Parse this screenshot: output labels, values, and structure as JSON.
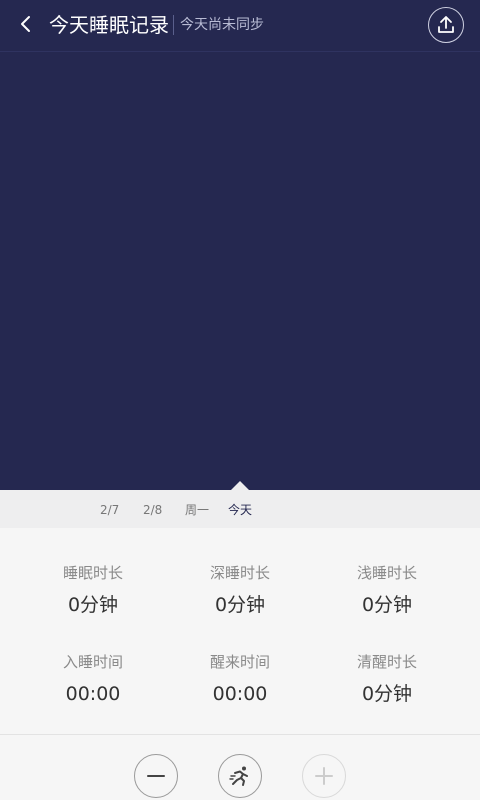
{
  "header": {
    "title": "今天睡眠记录",
    "subtitle": "今天尚未同步",
    "back_icon": "chevron-left-icon",
    "upload_icon": "upload-icon"
  },
  "date_tabs": [
    {
      "label": "2/7",
      "active": false
    },
    {
      "label": "2/8",
      "active": false
    },
    {
      "label": "周一",
      "active": false
    },
    {
      "label": "今天",
      "active": true
    }
  ],
  "stats": {
    "sleep_duration": {
      "label": "睡眠时长",
      "value": "0分钟"
    },
    "deep_sleep": {
      "label": "深睡时长",
      "value": "0分钟"
    },
    "light_sleep": {
      "label": "浅睡时长",
      "value": "0分钟"
    },
    "fall_asleep_time": {
      "label": "入睡时间",
      "value": "00:00"
    },
    "wake_time": {
      "label": "醒来时间",
      "value": "00:00"
    },
    "awake_duration": {
      "label": "清醒时长",
      "value": "0分钟"
    }
  },
  "toolbar": {
    "minus_icon": "minus-icon",
    "run_icon": "running-person-icon",
    "plus_icon": "plus-icon"
  },
  "colors": {
    "header_bg": "#252850",
    "accent": "#252850",
    "page_bg": "#f6f6f6"
  }
}
